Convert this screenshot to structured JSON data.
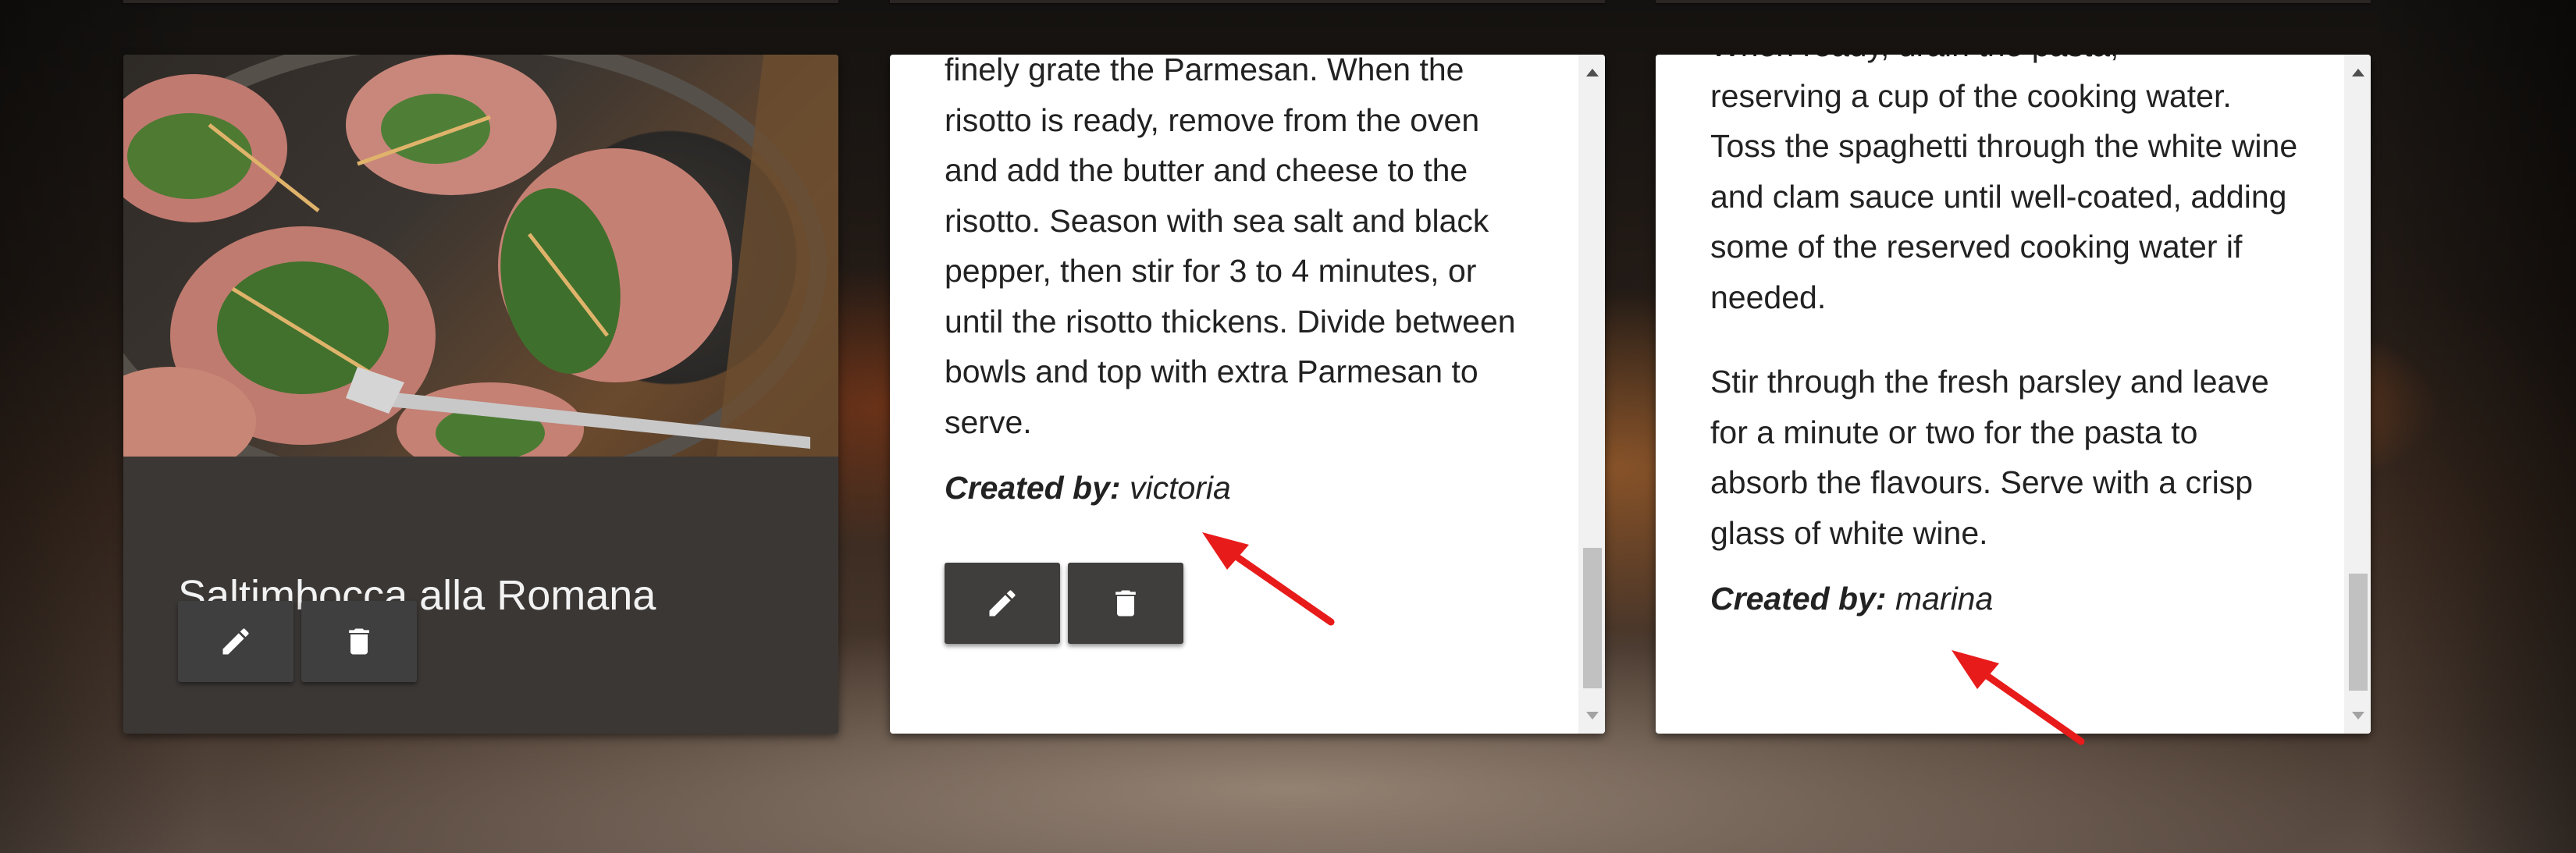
{
  "cards": [
    {
      "title": "Saltimbocca alla Romana",
      "image_icon": "recipe-photo"
    },
    {
      "paragraphs": [
        "finely grate the Parmesan. When the risotto is ready, remove from the oven and add the butter and cheese to the risotto. Season with sea salt and black pepper, then stir for 3 to 4 minutes, or until the risotto thickens. Divide between bowls and top with extra Parmesan to serve."
      ],
      "created_by_label": "Created by:",
      "created_by_user": "victoria"
    },
    {
      "partial_line": "When ready, drain the pasta,",
      "paragraphs": [
        "reserving a cup of the cooking water. Toss the spaghetti through the white wine and clam sauce until well-coated, adding some of the reserved cooking water if needed.",
        "Stir through the fresh parsley and leave for a minute or two for the pasta to absorb the flavours. Serve with a crisp glass of white wine."
      ],
      "created_by_label": "Created by:",
      "created_by_user": "marina"
    }
  ],
  "icons": {
    "edit": "pencil-icon",
    "delete": "trash-icon"
  },
  "colors": {
    "annotation_arrow": "#e81b1b",
    "button_bg": "#3f3f3f"
  }
}
